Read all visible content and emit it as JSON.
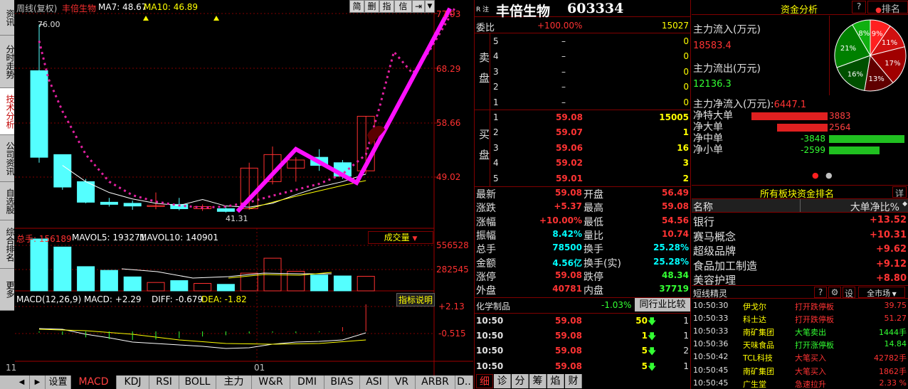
{
  "left_nav": [
    "资讯",
    "分时走势",
    "技术分析",
    "公司资讯",
    "自选股",
    "综合排名",
    "更多"
  ],
  "chart": {
    "header": {
      "period": "周线(复权)",
      "name": "丰倍生物",
      "ma7": "MA7: 48.67",
      "ma10": "MA10: 46.89"
    },
    "buttons": [
      "简",
      "删",
      "指",
      "信息"
    ],
    "price_axis": [
      "77.93",
      "68.29",
      "58.66",
      "49.02"
    ],
    "high_label": "76.00",
    "low_label": "41.31",
    "vol_header": {
      "total": "总手: 156189",
      "mavol5": "MAVOL5: 193271",
      "mavol10": "MAVOL10: 140901",
      "dropdown": "成交量"
    },
    "vol_axis": [
      "556528",
      "282545"
    ],
    "macd_header": {
      "macd": "MACD(12,26,9) MACD: +2.29",
      "diff": "DIFF: -0.679",
      "dea": "DEA: -1.82",
      "explain": "指标说明"
    },
    "macd_axis": [
      "+2.13",
      "-0.515"
    ],
    "x_labels": [
      "11",
      "01"
    ],
    "candles": [
      {
        "o": 67.5,
        "c": 51.5,
        "h": 76.0,
        "l": 50.5,
        "v": 556528
      },
      {
        "o": 52.0,
        "c": 46.0,
        "h": 52.0,
        "l": 45.5,
        "v": 470000
      },
      {
        "o": 47.0,
        "c": 43.2,
        "h": 47.5,
        "l": 43.0,
        "v": 260000
      },
      {
        "o": 43.2,
        "c": 42.8,
        "h": 44.0,
        "l": 42.4,
        "v": 220000
      },
      {
        "o": 43.0,
        "c": 42.5,
        "h": 43.5,
        "l": 41.8,
        "v": 150000
      },
      {
        "o": 42.5,
        "c": 42.6,
        "h": 45.0,
        "l": 41.9,
        "v": 90000
      },
      {
        "o": 42.8,
        "c": 42.0,
        "h": 44.0,
        "l": 41.7,
        "v": 110000
      },
      {
        "o": 42.0,
        "c": 42.4,
        "h": 42.8,
        "l": 41.6,
        "v": 80000
      },
      {
        "o": 42.0,
        "c": 41.5,
        "h": 42.6,
        "l": 41.31,
        "v": 70000
      },
      {
        "o": 42.0,
        "c": 49.5,
        "h": 50.5,
        "l": 41.8,
        "v": 190000
      },
      {
        "o": 47.0,
        "c": 52.0,
        "h": 53.5,
        "l": 46.5,
        "v": 350000
      },
      {
        "o": 49.5,
        "c": 51.0,
        "h": 51.5,
        "l": 47.0,
        "v": 210000
      },
      {
        "o": 51.5,
        "c": 50.0,
        "h": 53.0,
        "l": 49.0,
        "v": 170000
      },
      {
        "o": 50.5,
        "c": 48.0,
        "h": 51.0,
        "l": 47.5,
        "v": 160000
      },
      {
        "o": 49.0,
        "c": 59.08,
        "h": 59.08,
        "l": 48.5,
        "v": 156189
      }
    ],
    "ma_dotted": [
      {
        "w": 0,
        "p": 73
      },
      {
        "w": 0.4,
        "p": 66
      },
      {
        "w": 1,
        "p": 60
      },
      {
        "w": 2,
        "p": 52
      },
      {
        "w": 3,
        "p": 47
      },
      {
        "w": 4,
        "p": 44.5
      },
      {
        "w": 5,
        "p": 43.3
      },
      {
        "w": 6,
        "p": 42.6
      },
      {
        "w": 7,
        "p": 42.2
      },
      {
        "w": 8,
        "p": 42.4
      },
      {
        "w": 9,
        "p": 43.2
      },
      {
        "w": 10,
        "p": 44.4
      },
      {
        "w": 11,
        "p": 45.5
      },
      {
        "w": 12,
        "p": 46.6
      },
      {
        "w": 13,
        "p": 48.4
      },
      {
        "w": 14,
        "p": 52
      },
      {
        "w": 14.6,
        "p": 61
      },
      {
        "w": 15.2,
        "p": 71
      },
      {
        "w": 16,
        "p": 67
      },
      {
        "w": 16.7,
        "p": 71
      },
      {
        "w": 17.8,
        "p": 79
      }
    ],
    "magenta": [
      {
        "w": 8.5,
        "p": 41.5
      },
      {
        "w": 11,
        "p": 53
      },
      {
        "w": 13.6,
        "p": 46.8
      },
      {
        "w": 17.6,
        "p": 79
      }
    ]
  },
  "tabs": [
    "设置",
    "MACD",
    "KDJ",
    "RSI",
    "BOLL",
    "主力",
    "W&R",
    "DMI",
    "BIAS",
    "ASI",
    "VR",
    "ARBR",
    "D.."
  ],
  "quote": {
    "title": "丰倍生物",
    "code": "603334",
    "badge": "R 注",
    "weibi": {
      "label": "委比",
      "pct": "+100.00%",
      "val": "15027"
    },
    "sell_label": "卖盘",
    "buy_label": "买盘",
    "sells": [
      {
        "lv": "5",
        "p": "–",
        "v": "0"
      },
      {
        "lv": "4",
        "p": "–",
        "v": "0"
      },
      {
        "lv": "3",
        "p": "–",
        "v": "0"
      },
      {
        "lv": "2",
        "p": "–",
        "v": "0"
      },
      {
        "lv": "1",
        "p": "–",
        "v": "0"
      }
    ],
    "buys": [
      {
        "lv": "1",
        "p": "59.08",
        "v": "15005"
      },
      {
        "lv": "2",
        "p": "59.07",
        "v": "1"
      },
      {
        "lv": "3",
        "p": "59.06",
        "v": "16"
      },
      {
        "lv": "4",
        "p": "59.02",
        "v": "3"
      },
      {
        "lv": "5",
        "p": "59.01",
        "v": "2"
      }
    ],
    "stats": [
      {
        "l1": "最新",
        "v1": "59.08",
        "c1": "red",
        "l2": "开盘",
        "v2": "56.49",
        "c2": "red"
      },
      {
        "l1": "涨跌",
        "v1": "+5.37",
        "c1": "red",
        "l2": "最高",
        "v2": "59.08",
        "c2": "red"
      },
      {
        "l1": "涨幅",
        "v1": "+10.00%",
        "c1": "red",
        "l2": "最低",
        "v2": "54.56",
        "c2": "red"
      },
      {
        "l1": "振幅",
        "v1": "8.42%",
        "c1": "cyan",
        "l2": "量比",
        "v2": "10.74",
        "c2": "red"
      },
      {
        "l1": "总手",
        "v1": "78500",
        "c1": "cyan",
        "l2": "换手",
        "v2": "25.28%",
        "c2": "cyan"
      },
      {
        "l1": "金额",
        "v1": "4.56亿",
        "c1": "cyan",
        "l2": "换手(实)",
        "v2": "25.28%",
        "c2": "cyan"
      },
      {
        "l1": "涨停",
        "v1": "59.08",
        "c1": "red",
        "l2": "跌停",
        "v2": "48.34",
        "c2": "green"
      },
      {
        "l1": "外盘",
        "v1": "40781",
        "c1": "red",
        "l2": "内盘",
        "v2": "37719",
        "c2": "green"
      }
    ],
    "industry": {
      "name": "化学制品",
      "pct": "-1.03%",
      "btn": "同行业比较"
    },
    "ticks": [
      {
        "t": "10:50",
        "p": "59.08",
        "v": "50",
        "n": "1"
      },
      {
        "t": "10:50",
        "p": "59.08",
        "v": "1",
        "n": "1"
      },
      {
        "t": "10:50",
        "p": "59.08",
        "v": "5",
        "n": "2"
      },
      {
        "t": "10:50",
        "p": "59.08",
        "v": "5",
        "n": "1"
      }
    ],
    "bottom_tabs": [
      "细",
      "诊",
      "分",
      "筹",
      "焰",
      "财"
    ]
  },
  "money": {
    "title": "资金分析",
    "q": "?",
    "rank": "排名",
    "inflow_label": "主力流入(万元)",
    "inflow": "18583.4",
    "outflow_label": "主力流出(万元)",
    "outflow": "12136.3",
    "net_label": "主力净流入(万元):",
    "net": "6447.1",
    "pie": [
      {
        "pct": "9%",
        "v": 9,
        "color": "#ff2020"
      },
      {
        "pct": "11%",
        "v": 11,
        "color": "#d01010"
      },
      {
        "pct": "17%",
        "v": 17,
        "color": "#a00000"
      },
      {
        "pct": "13%",
        "v": 13,
        "color": "#600000"
      },
      {
        "pct": "16%",
        "v": 16,
        "color": "#005000"
      },
      {
        "pct": "21%",
        "v": 21,
        "color": "#008000"
      },
      {
        "pct": "8%",
        "v": 8,
        "color": "#10b010"
      }
    ],
    "net_items": [
      {
        "label": "净特大单",
        "val": "3883",
        "dir": "pos",
        "mag": 3883
      },
      {
        "label": "净大单",
        "val": "2564",
        "dir": "pos",
        "mag": 2564
      },
      {
        "label": "净中单",
        "val": "-3848",
        "dir": "neg",
        "mag": 3848
      },
      {
        "label": "净小单",
        "val": "-2599",
        "dir": "neg",
        "mag": 2599
      }
    ],
    "board_title": "所有板块资金排名",
    "board_detail": "详",
    "board_cols": [
      "名称",
      "大单净比%"
    ],
    "boards": [
      {
        "n": "银行",
        "v": "+13.52"
      },
      {
        "n": "赛马概念",
        "v": "+10.31"
      },
      {
        "n": "超级品牌",
        "v": "+9.62"
      },
      {
        "n": "食品加工制造",
        "v": "+9.12"
      },
      {
        "n": "美容护理",
        "v": "+8.80"
      }
    ],
    "elf": {
      "title": "短线精灵",
      "q": "?",
      "gear": "⚙",
      "settings": "设",
      "market": "全市场"
    },
    "elf_rows": [
      {
        "t": "10:50:30",
        "n": "伊戈尔",
        "a": "打开跌停板",
        "v": "39.75",
        "c": "red"
      },
      {
        "t": "10:50:33",
        "n": "科士达",
        "a": "打开跌停板",
        "v": "51.27",
        "c": "red"
      },
      {
        "t": "10:50:33",
        "n": "南矿集团",
        "a": "大笔卖出",
        "v": "1444手",
        "c": "green"
      },
      {
        "t": "10:50:36",
        "n": "天味食品",
        "a": "打开涨停板",
        "v": "14.84",
        "c": "green"
      },
      {
        "t": "10:50:42",
        "n": "TCL科技",
        "a": "大笔买入",
        "v": "42782手",
        "c": "red"
      },
      {
        "t": "10:50:45",
        "n": "南矿集团",
        "a": "大笔买入",
        "v": "1862手",
        "c": "red"
      },
      {
        "t": "10:50:45",
        "n": "广生堂",
        "a": "急速拉升",
        "v": "2.33 %",
        "c": "red"
      }
    ]
  }
}
